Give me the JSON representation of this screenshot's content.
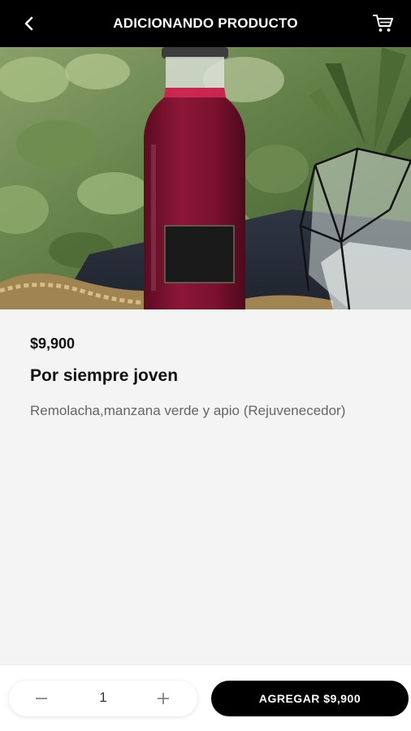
{
  "header": {
    "title": "ADICIONANDO PRODUCTO",
    "back_icon": "chevron-left-icon",
    "cart_icon": "cart-icon"
  },
  "product": {
    "price": "$9,900",
    "name": "Por siempre joven",
    "description": "Remolacha,manzana verde y apio (Rejuvenecedor)"
  },
  "quantity": {
    "minus_label": "−",
    "value": "1",
    "plus_label": "+"
  },
  "add_button": {
    "label": "AGREGAR $9,900"
  },
  "colors": {
    "header_bg": "#000000",
    "page_bg": "#f4f4f4",
    "button_bg": "#000000",
    "juice": "#7a1230"
  }
}
